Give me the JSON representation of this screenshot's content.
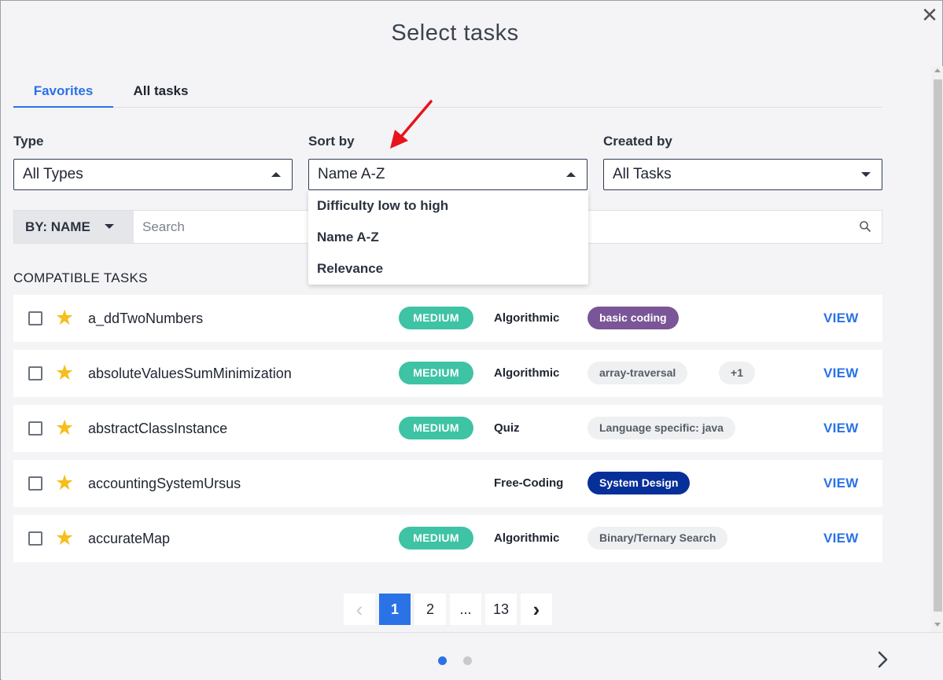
{
  "modal": {
    "title": "Select tasks",
    "close_glyph": "✕"
  },
  "tabs": [
    {
      "label": "Favorites",
      "active": true
    },
    {
      "label": "All tasks",
      "active": false
    }
  ],
  "filters": {
    "type": {
      "label": "Type",
      "value": "All Types"
    },
    "sort": {
      "label": "Sort by",
      "value": "Name A-Z",
      "options": [
        "Difficulty low to high",
        "Name A-Z",
        "Relevance"
      ],
      "open": true
    },
    "created": {
      "label": "Created by",
      "value": "All Tasks"
    }
  },
  "search": {
    "by_label": "BY: NAME",
    "placeholder": "Search"
  },
  "section_label": "COMPATIBLE TASKS",
  "tasks": [
    {
      "name": "a_ddTwoNumbers",
      "difficulty": "MEDIUM",
      "type": "Algorithmic",
      "tag": "basic coding",
      "tag_color": "#7a5597",
      "extra": "",
      "action": "VIEW"
    },
    {
      "name": "absoluteValuesSumMinimization",
      "difficulty": "MEDIUM",
      "type": "Algorithmic",
      "tag": "array-traversal",
      "tag_color": "#eef0f2",
      "extra": "+1",
      "action": "VIEW"
    },
    {
      "name": "abstractClassInstance",
      "difficulty": "MEDIUM",
      "type": "Quiz",
      "tag": "Language specific: java",
      "tag_color": "#eef0f2",
      "extra": "",
      "action": "VIEW"
    },
    {
      "name": "accountingSystemUrsus",
      "difficulty": "",
      "type": "Free-Coding",
      "tag": "System Design",
      "tag_color": "#072f9a",
      "extra": "",
      "action": "VIEW"
    },
    {
      "name": "accurateMap",
      "difficulty": "MEDIUM",
      "type": "Algorithmic",
      "tag": "Binary/Ternary Search",
      "tag_color": "#eef0f2",
      "extra": "",
      "action": "VIEW"
    }
  ],
  "pagination": {
    "prev": "‹",
    "pages": [
      "1",
      "2",
      "...",
      "13"
    ],
    "current": "1",
    "next": "›"
  },
  "footer": {
    "dots": 2,
    "active_dot": 0
  },
  "colors": {
    "accent": "#2a72e6",
    "difficulty_medium": "#3ec3a4",
    "star": "#f5be1a",
    "annotation_arrow": "#e8141b"
  }
}
